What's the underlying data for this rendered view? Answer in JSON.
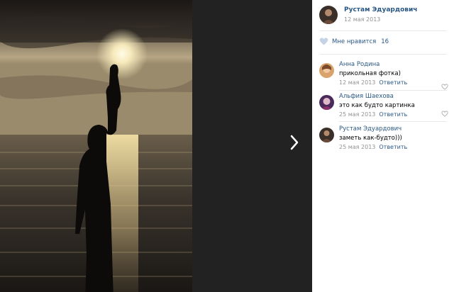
{
  "post": {
    "author_name": "Рустам Эдуардович",
    "date": "12 мая 2013"
  },
  "likes": {
    "label": "Мне нравится",
    "count": "16"
  },
  "comments": [
    {
      "name": "Анна Родина",
      "text": "прикольная фотка)",
      "date": "12 мая 2013",
      "reply": "Ответить"
    },
    {
      "name": "Альфия Шаехова",
      "text": "это как будто картинка",
      "date": "25 мая 2013",
      "reply": "Ответить"
    },
    {
      "name": "Рустам Эдуардович",
      "text": "заметь как-будто)))",
      "date": "25 мая 2013",
      "reply": "Ответить"
    }
  ],
  "colors": {
    "link": "#2a5885",
    "muted": "#939393",
    "viewer_bg": "#222222"
  },
  "icons": {
    "next": "chevron-right-icon",
    "like": "heart-icon"
  }
}
